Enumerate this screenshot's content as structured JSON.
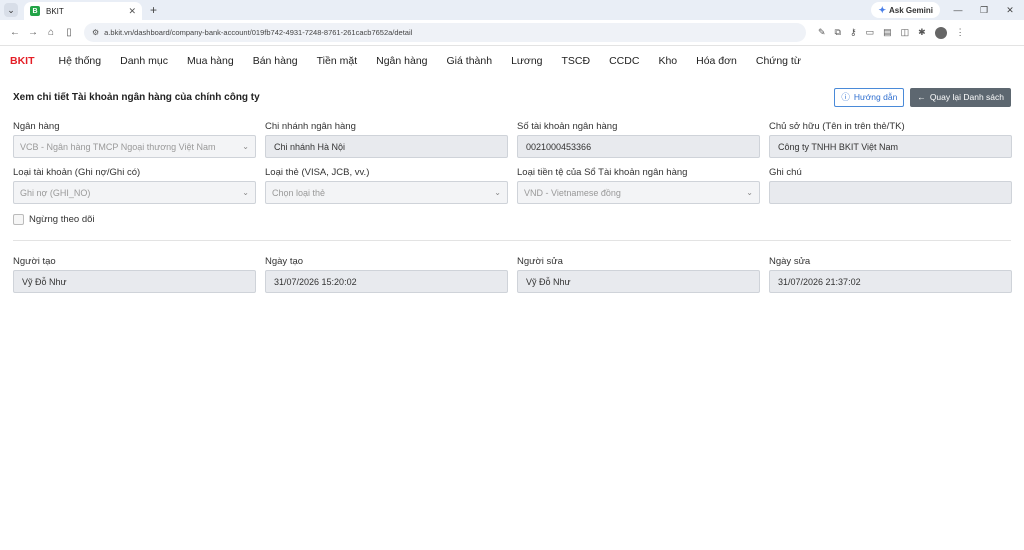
{
  "browser": {
    "tab_title": "BKIT",
    "favicon_letter": "B",
    "url": "a.bkit.vn/dashboard/company-bank-account/019fb742-4931-7248-8761-261cacb7652a/detail",
    "gemini_label": "Ask Gemini"
  },
  "app": {
    "brand": "BKIT",
    "nav": [
      "Hệ thống",
      "Danh mục",
      "Mua hàng",
      "Bán hàng",
      "Tiền mặt",
      "Ngân hàng",
      "Giá thành",
      "Lương",
      "TSCĐ",
      "CCDC",
      "Kho",
      "Hóa đơn",
      "Chứng từ"
    ]
  },
  "page": {
    "title": "Xem chi tiết Tài khoản ngân hàng của chính công ty",
    "help_label": "Hướng dẫn",
    "back_label": "Quay lại Danh sách"
  },
  "form": {
    "bank_label": "Ngân hàng",
    "bank_value": "VCB - Ngân hàng TMCP Ngoại thương Việt Nam",
    "branch_label": "Chi nhánh ngân hàng",
    "branch_value": "Chi nhánh Hà Nội",
    "account_no_label": "Số tài khoản ngân hàng",
    "account_no_value": "0021000453366",
    "owner_label": "Chủ sở hữu (Tên in trên thẻ/TK)",
    "owner_value": "Công ty TNHH BKIT Việt Nam",
    "acc_type_label": "Loại tài khoản (Ghi nợ/Ghi có)",
    "acc_type_value": "Ghi nợ (GHI_NO)",
    "card_type_label": "Loại thẻ (VISA, JCB, vv.)",
    "card_type_placeholder": "Chọn loại thẻ",
    "currency_label": "Loại tiền tệ của Sổ Tài khoản ngân hàng",
    "currency_value": "VND - Vietnamese đồng",
    "note_label": "Ghi chú",
    "note_value": "",
    "stop_tracking_label": "Ngừng theo dõi",
    "created_by_label": "Người tạo",
    "created_by_value": "Vỹ Đỗ Như",
    "created_at_label": "Ngày tạo",
    "created_at_value": "31/07/2026 15:20:02",
    "updated_by_label": "Người sửa",
    "updated_by_value": "Vỹ Đỗ Như",
    "updated_at_label": "Ngày sửa",
    "updated_at_value": "31/07/2026 21:37:02"
  }
}
